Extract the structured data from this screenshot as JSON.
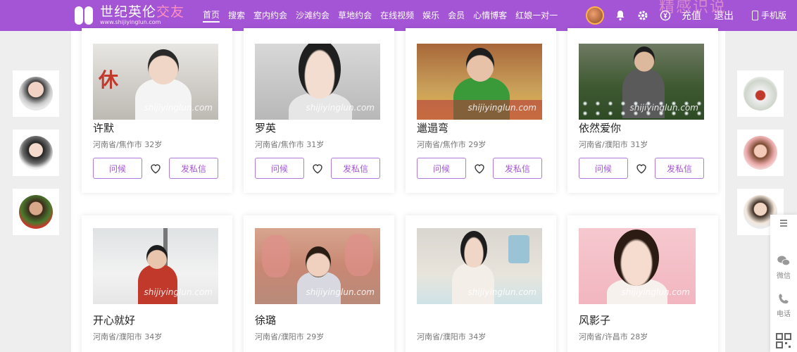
{
  "header": {
    "logo_title_a": "世纪英伦",
    "logo_title_b": "交友",
    "logo_url": "www.shijiyinglun.com",
    "nav": [
      "首页",
      "搜索",
      "室内约会",
      "沙滩约会",
      "草地约会",
      "在线视频",
      "娱乐",
      "会员",
      "心情博客",
      "红娘一对一"
    ],
    "active_nav": "首页",
    "recharge": "充值",
    "logout": "退出",
    "mobile": "手机版",
    "watermark": "精感识说",
    "colors": {
      "brand": "#a455d6"
    }
  },
  "watermark_text": "shijiyinglun.com",
  "cards": [
    {
      "name": "许默",
      "location": "河南省/焦作市",
      "age": "32岁",
      "greet": "问候",
      "message": "发私信"
    },
    {
      "name": "罗英",
      "location": "河南省/焦作市",
      "age": "31岁",
      "greet": "问候",
      "message": "发私信"
    },
    {
      "name": "邋遢弯",
      "location": "河南省/焦作市",
      "age": "29岁",
      "greet": "问候",
      "message": "发私信"
    },
    {
      "name": "依然爱你",
      "location": "河南省/濮阳市",
      "age": "31岁",
      "greet": "问候",
      "message": "发私信"
    },
    {
      "name": "开心就好",
      "location": "河南省/濮阳市",
      "age": "34岁"
    },
    {
      "name": "徐璐",
      "location": "河南省/濮阳市",
      "age": "29岁"
    },
    {
      "name": "",
      "location": "河南省/濮阳市",
      "age": "34岁"
    },
    {
      "name": "风影子",
      "location": "河南省/许昌市",
      "age": "28岁"
    }
  ],
  "utility": {
    "menu_icon": "menu-icon",
    "wechat": "微信",
    "phone": "电话",
    "qr_icon": "qr-code-icon"
  }
}
